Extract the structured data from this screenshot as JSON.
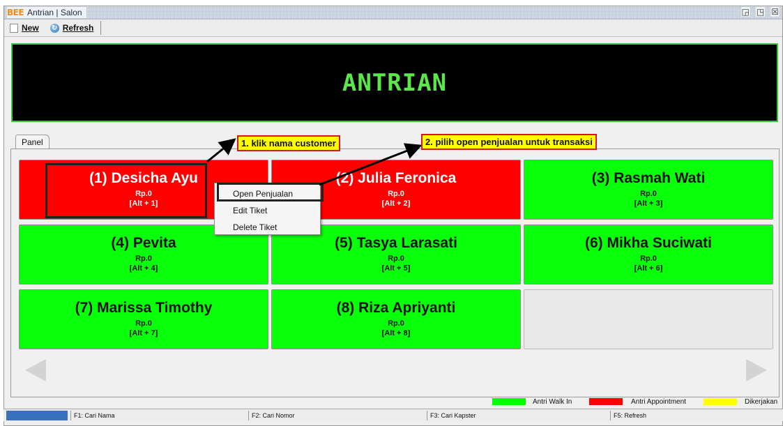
{
  "window": {
    "logo": "BEE",
    "title": "Antrian | Salon",
    "controls": [
      "restore-icon",
      "maximize-icon",
      "close-icon"
    ]
  },
  "toolbar": {
    "new_label": "New",
    "refresh_label": "Refresh"
  },
  "banner": {
    "title": "ANTRIAN"
  },
  "tab": {
    "label": "Panel"
  },
  "queue": [
    {
      "name": "(1) Desicha Ayu",
      "amount": "Rp.0",
      "shortcut": "[Alt + 1]",
      "status": "Antri Appointment"
    },
    {
      "name": "(2) Julia Feronica",
      "amount": "Rp.0",
      "shortcut": "[Alt + 2]",
      "status": "Antri Appointment"
    },
    {
      "name": "(3) Rasmah Wati",
      "amount": "Rp.0",
      "shortcut": "[Alt + 3]",
      "status": "Antri Walk In"
    },
    {
      "name": "(4) Pevita",
      "amount": "Rp.0",
      "shortcut": "[Alt + 4]",
      "status": "Antri Walk In"
    },
    {
      "name": "(5) Tasya Larasati",
      "amount": "Rp.0",
      "shortcut": "[Alt + 5]",
      "status": "Antri Walk In"
    },
    {
      "name": "(6) Mikha Suciwati",
      "amount": "Rp.0",
      "shortcut": "[Alt + 6]",
      "status": "Antri Walk In"
    },
    {
      "name": "(7) Marissa Timothy",
      "amount": "Rp.0",
      "shortcut": "[Alt + 7]",
      "status": "Antri Walk In"
    },
    {
      "name": "(8) Riza Apriyanti",
      "amount": "Rp.0",
      "shortcut": "[Alt + 8]",
      "status": "Antri Walk In"
    }
  ],
  "context_menu": {
    "items": [
      "Open Penjualan",
      "Edit Tiket",
      "Delete Tiket"
    ]
  },
  "callouts": {
    "step1": "1. klik nama customer",
    "step2": "2. pilih open penjualan untuk transaksi"
  },
  "legend": [
    {
      "label": "Antri Walk In",
      "color": "#00ff00"
    },
    {
      "label": "Antri Appointment",
      "color": "#ff0000"
    },
    {
      "label": "Dikerjakan",
      "color": "#ffff00"
    }
  ],
  "statusbar": {
    "cells": [
      "F1: Cari Nama",
      "F2: Cari Nomor",
      "F3: Cari Kapster",
      "F5: Refresh"
    ]
  },
  "nav": {
    "prev_icon": "arrow-left-icon",
    "next_icon": "arrow-right-icon"
  }
}
